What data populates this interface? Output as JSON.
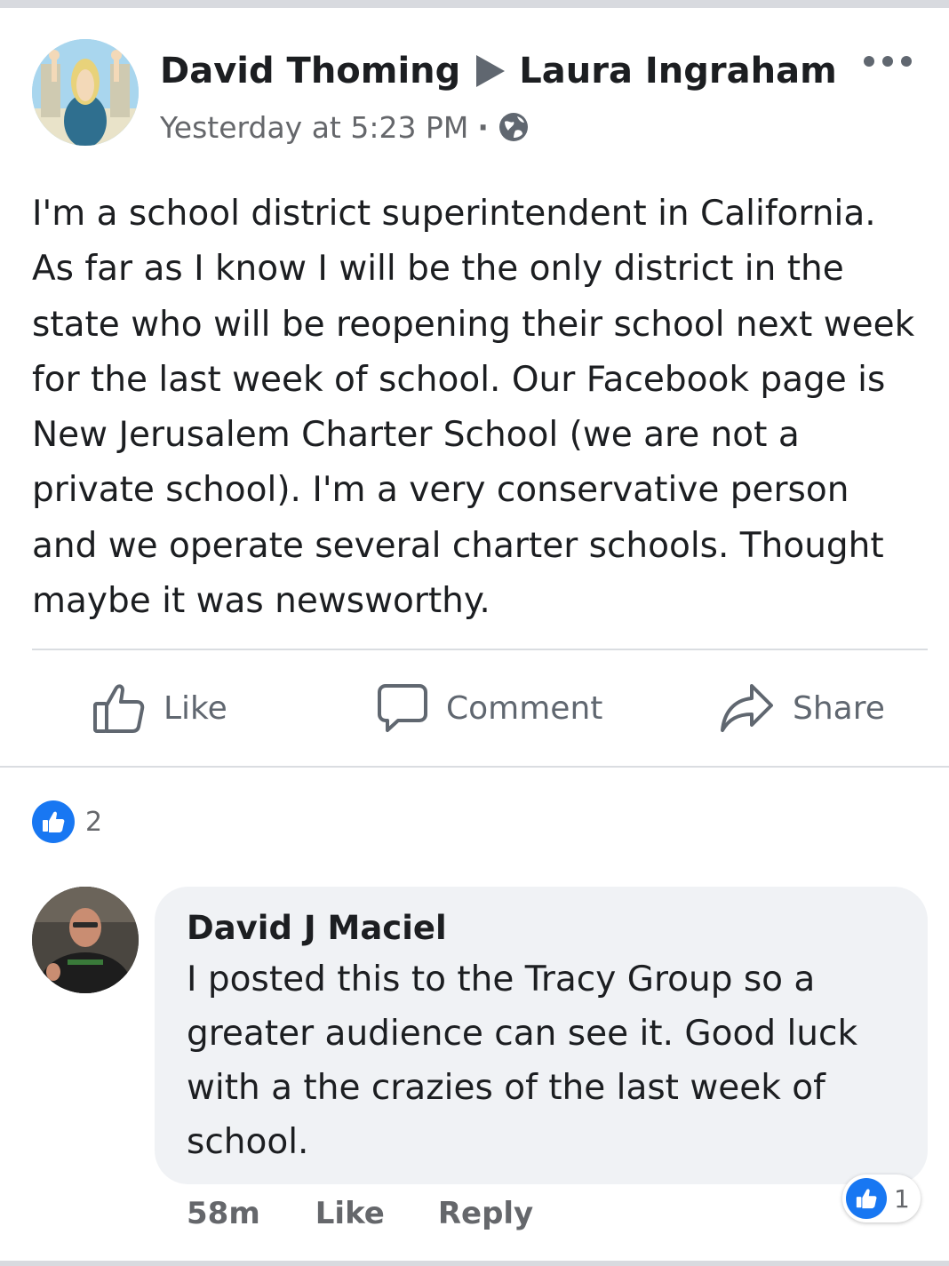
{
  "post": {
    "author": "David Thoming",
    "target": "Laura Ingraham",
    "timestamp": "Yesterday at 5:23 PM",
    "meta_separator": "·",
    "privacy_icon": "globe-icon",
    "more_icon": "more-options-icon",
    "text": "I'm a school district superintendent in California.\nAs far as I know I will be the only district in the\nstate who will be reopening their school next week\nfor the last week of school.  Our Facebook page is\nNew Jerusalem Charter School (we are not a\nprivate school).  I'm a very conservative person\nand we operate several charter schools.  Thought\nmaybe it was newsworthy."
  },
  "actions": {
    "like_label": "Like",
    "comment_label": "Comment",
    "share_label": "Share"
  },
  "reactions": {
    "count": "2"
  },
  "comment": {
    "author": "David J Maciel",
    "text": "I posted this to the Tracy Group so a\ngreater audience can see it. Good luck\nwith a the crazies of the last week of\nschool.",
    "time": "58m",
    "like_label": "Like",
    "reply_label": "Reply",
    "reaction_count": "1"
  },
  "colors": {
    "accent": "#1877f2",
    "text": "#1c1e21",
    "muted": "#65676b",
    "bubble": "#f0f2f5"
  }
}
